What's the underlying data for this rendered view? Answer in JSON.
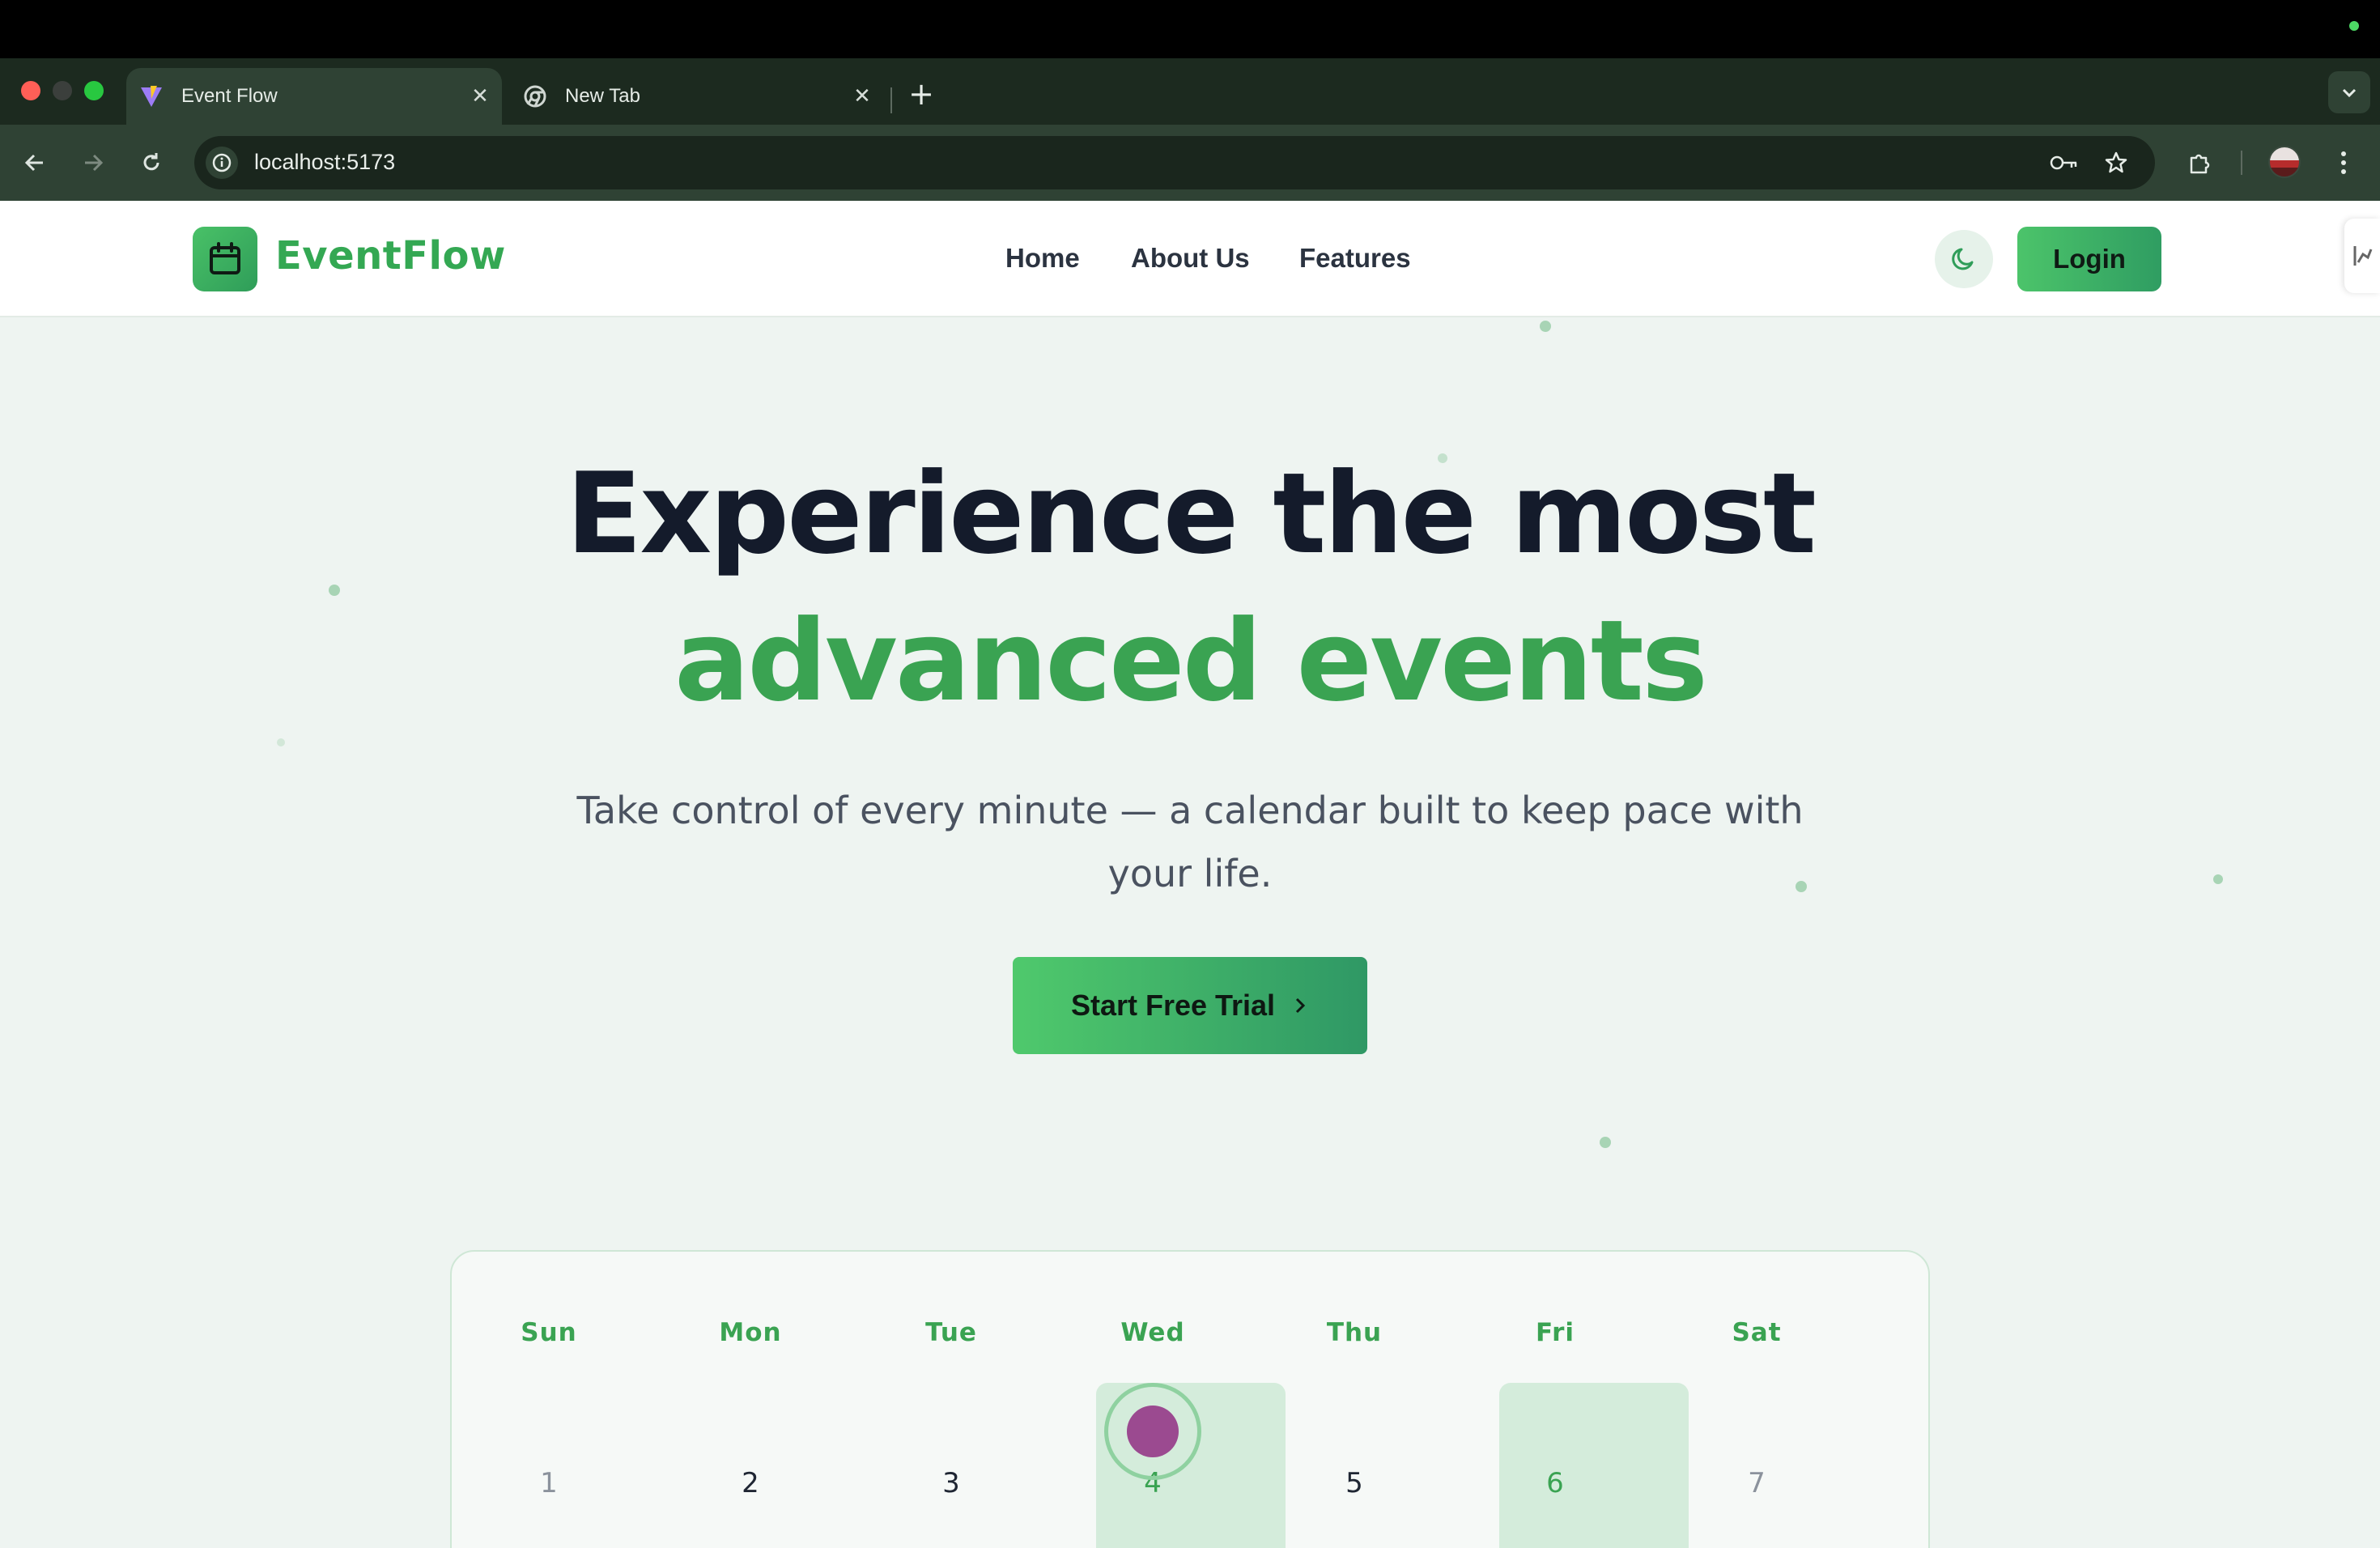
{
  "browser": {
    "tabs": [
      {
        "title": "Event Flow",
        "favicon": "vite-icon",
        "active": true
      },
      {
        "title": "New Tab",
        "favicon": "chrome-icon",
        "active": false
      }
    ],
    "url": "localhost:5173"
  },
  "site": {
    "brand": "EventFlow",
    "nav": [
      "Home",
      "About Us",
      "Features"
    ],
    "login": "Login"
  },
  "hero": {
    "title_line1": "Experience the most",
    "title_line2": "advanced events",
    "subtitle": "Take control of every minute — a calendar built to keep pace with your life.",
    "cta": "Start Free Trial"
  },
  "calendar": {
    "days": [
      "Sun",
      "Mon",
      "Tue",
      "Wed",
      "Thu",
      "Fri",
      "Sat"
    ],
    "dates": [
      "1",
      "2",
      "3",
      "4",
      "5",
      "6",
      "7"
    ],
    "highlighted_dates": [
      "4",
      "6"
    ]
  },
  "colors": {
    "brand_green": "#34a853",
    "heading_dark": "#141b2b",
    "event_purple": "#9b4a90"
  }
}
